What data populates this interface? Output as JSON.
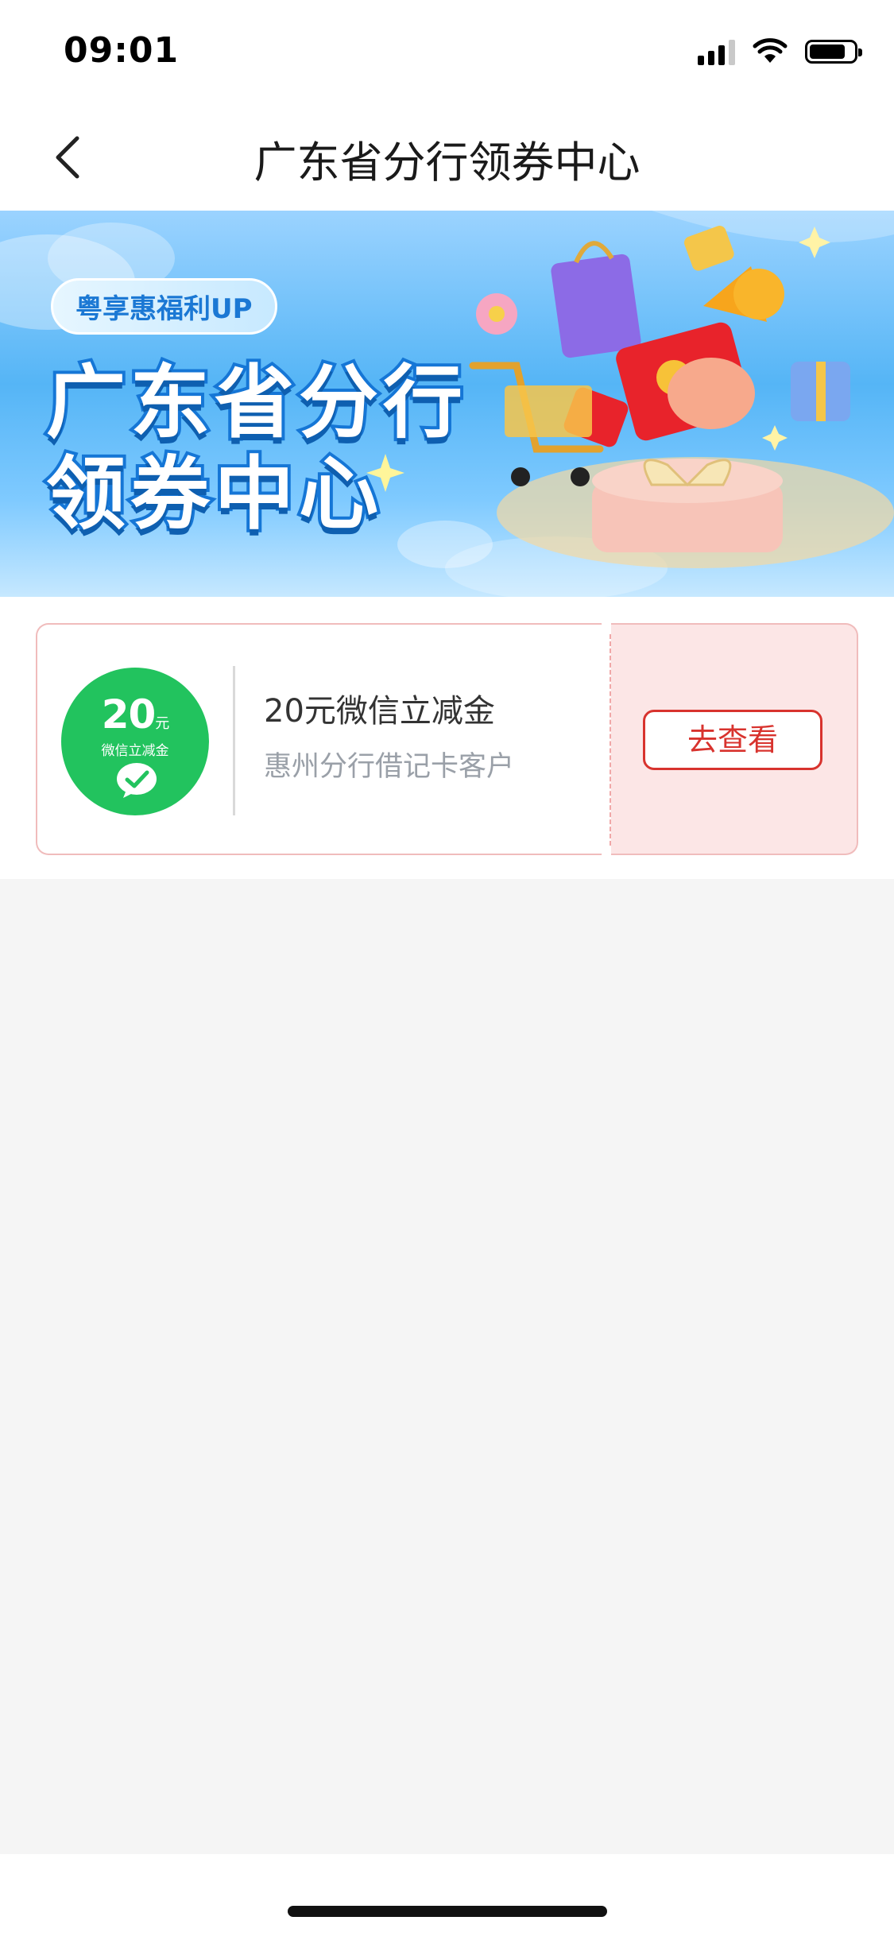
{
  "status_bar": {
    "time": "09:01"
  },
  "nav": {
    "title": "广东省分行领券中心"
  },
  "banner": {
    "badge": "粤享惠福利UP",
    "line1": "广东省分行",
    "line2": "领券中心"
  },
  "coupon": {
    "coin_amount": "20",
    "coin_unit": "元",
    "coin_label": "微信立减金",
    "title": "20元微信立减金",
    "description": "惠州分行借记卡客户",
    "button_label": "去查看"
  },
  "colors": {
    "accent_red": "#d8332e",
    "wechat_green": "#22c35e",
    "banner_blue": "#55b5f6"
  }
}
